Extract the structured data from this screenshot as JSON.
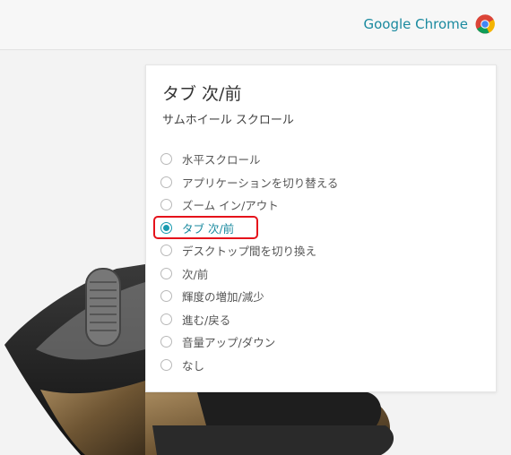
{
  "header": {
    "app_name": "Google Chrome",
    "app_icon": "chrome-icon"
  },
  "panel": {
    "title": "タブ 次/前",
    "subtitle": "サムホイール スクロール",
    "selected_index": 3,
    "options": [
      {
        "label": "水平スクロール",
        "selected": false
      },
      {
        "label": "アプリケーションを切り替える",
        "selected": false
      },
      {
        "label": "ズーム イン/アウト",
        "selected": false
      },
      {
        "label": "タブ 次/前",
        "selected": true
      },
      {
        "label": "デスクトップ間を切り換え",
        "selected": false
      },
      {
        "label": "次/前",
        "selected": false
      },
      {
        "label": "輝度の増加/減少",
        "selected": false
      },
      {
        "label": "進む/戻る",
        "selected": false
      },
      {
        "label": "音量アップ/ダウン",
        "selected": false
      },
      {
        "label": "なし",
        "selected": false
      }
    ]
  },
  "colors": {
    "accent": "#1a9bb0",
    "highlight": "#e5121b"
  }
}
